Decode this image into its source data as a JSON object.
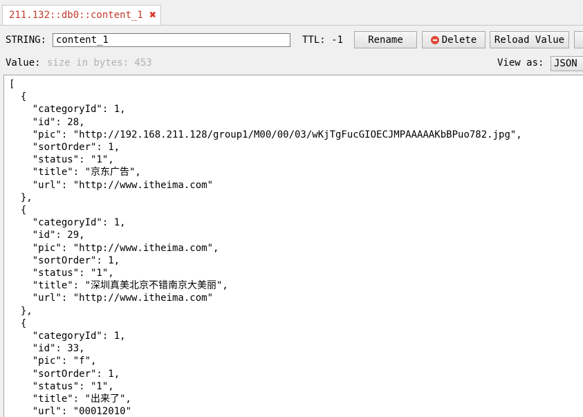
{
  "tab": {
    "title": "211.132::db0::content_1",
    "close_icon": "close-icon"
  },
  "toolbar": {
    "type_label": "STRING:",
    "key_value": "content_1",
    "ttl_label": "TTL:",
    "ttl_value": "-1",
    "rename_label": "Rename",
    "delete_label": "Delete",
    "reload_label": "Reload Value"
  },
  "value_row": {
    "label": "Value:",
    "hint": "size in bytes: 453",
    "view_as_label": "View as:",
    "view_as_selected": "JSON"
  },
  "editor": {
    "lines": [
      "[",
      "  {",
      "    \"categoryId\": 1,",
      "    \"id\": 28,",
      "    \"pic\": \"http://192.168.211.128/group1/M00/00/03/wKjTgFucGIOECJMPAAAAAKbBPuo782.jpg\",",
      "    \"sortOrder\": 1,",
      "    \"status\": \"1\",",
      "    \"title\": \"京东广告\",",
      "    \"url\": \"http://www.itheima.com\"",
      "  },",
      "  {",
      "    \"categoryId\": 1,",
      "    \"id\": 29,",
      "    \"pic\": \"http://www.itheima.com\",",
      "    \"sortOrder\": 1,",
      "    \"status\": \"1\",",
      "    \"title\": \"深圳真美北京不错南京大美丽\",",
      "    \"url\": \"http://www.itheima.com\"",
      "  },",
      "  {",
      "    \"categoryId\": 1,",
      "    \"id\": 33,",
      "    \"pic\": \"f\",",
      "    \"sortOrder\": 1,",
      "    \"status\": \"1\",",
      "    \"title\": \"出来了\",",
      "    \"url\": \"00012010\""
    ]
  }
}
